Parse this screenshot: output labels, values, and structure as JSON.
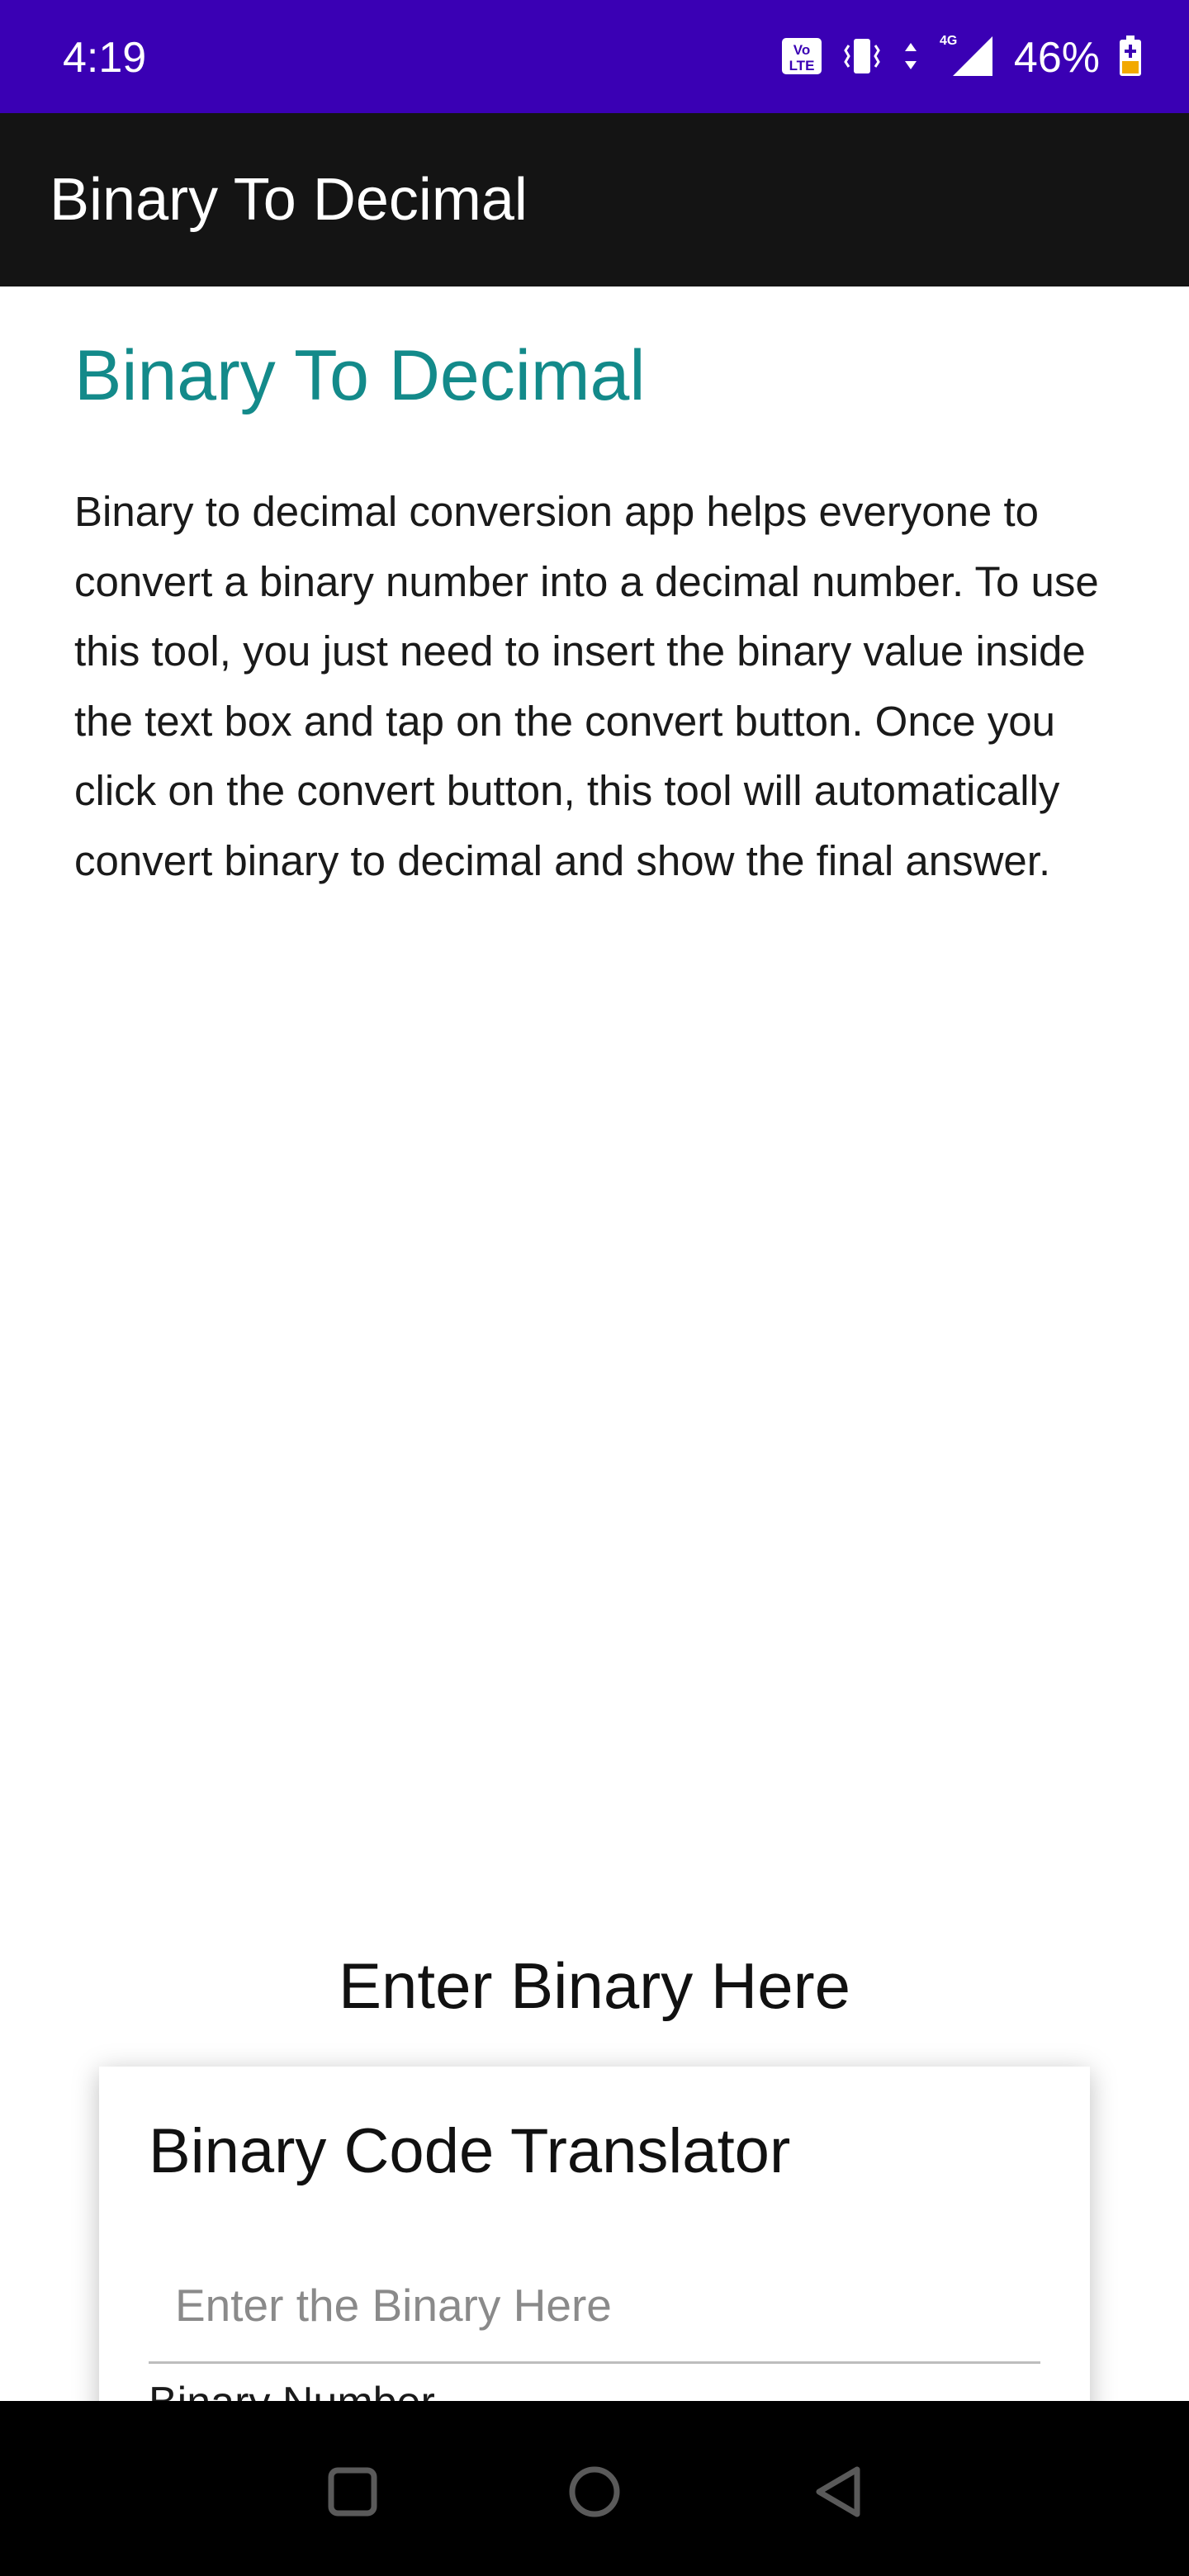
{
  "status_bar": {
    "time": "4:19",
    "battery_percent": "46%",
    "network_label": "4G",
    "volte_label": "Vo LTE",
    "icons": [
      "volte-icon",
      "vibrate-icon",
      "data-arrows-icon",
      "signal-icon",
      "battery-charging-icon"
    ],
    "background_color": "#3a00b4"
  },
  "app_bar": {
    "title": "Binary To Decimal",
    "background_color": "#141414"
  },
  "content": {
    "title": "Binary To Decimal",
    "title_color": "#138a8a",
    "description": "Binary to decimal conversion app helps everyone to convert a binary number into a decimal number. To use this tool, you just need to insert the binary value inside the text box and tap on the convert button. Once you click on the convert button, this tool will automatically convert binary to decimal and show the final answer."
  },
  "converter": {
    "section_heading": "Enter Binary Here",
    "card_title": "Binary Code Translator",
    "input_placeholder": "Enter the Binary Here",
    "input_value": "",
    "field_label": "Binary Number"
  },
  "nav_bar": {
    "icons": [
      "recents-square-icon",
      "home-circle-icon",
      "back-triangle-icon"
    ]
  }
}
